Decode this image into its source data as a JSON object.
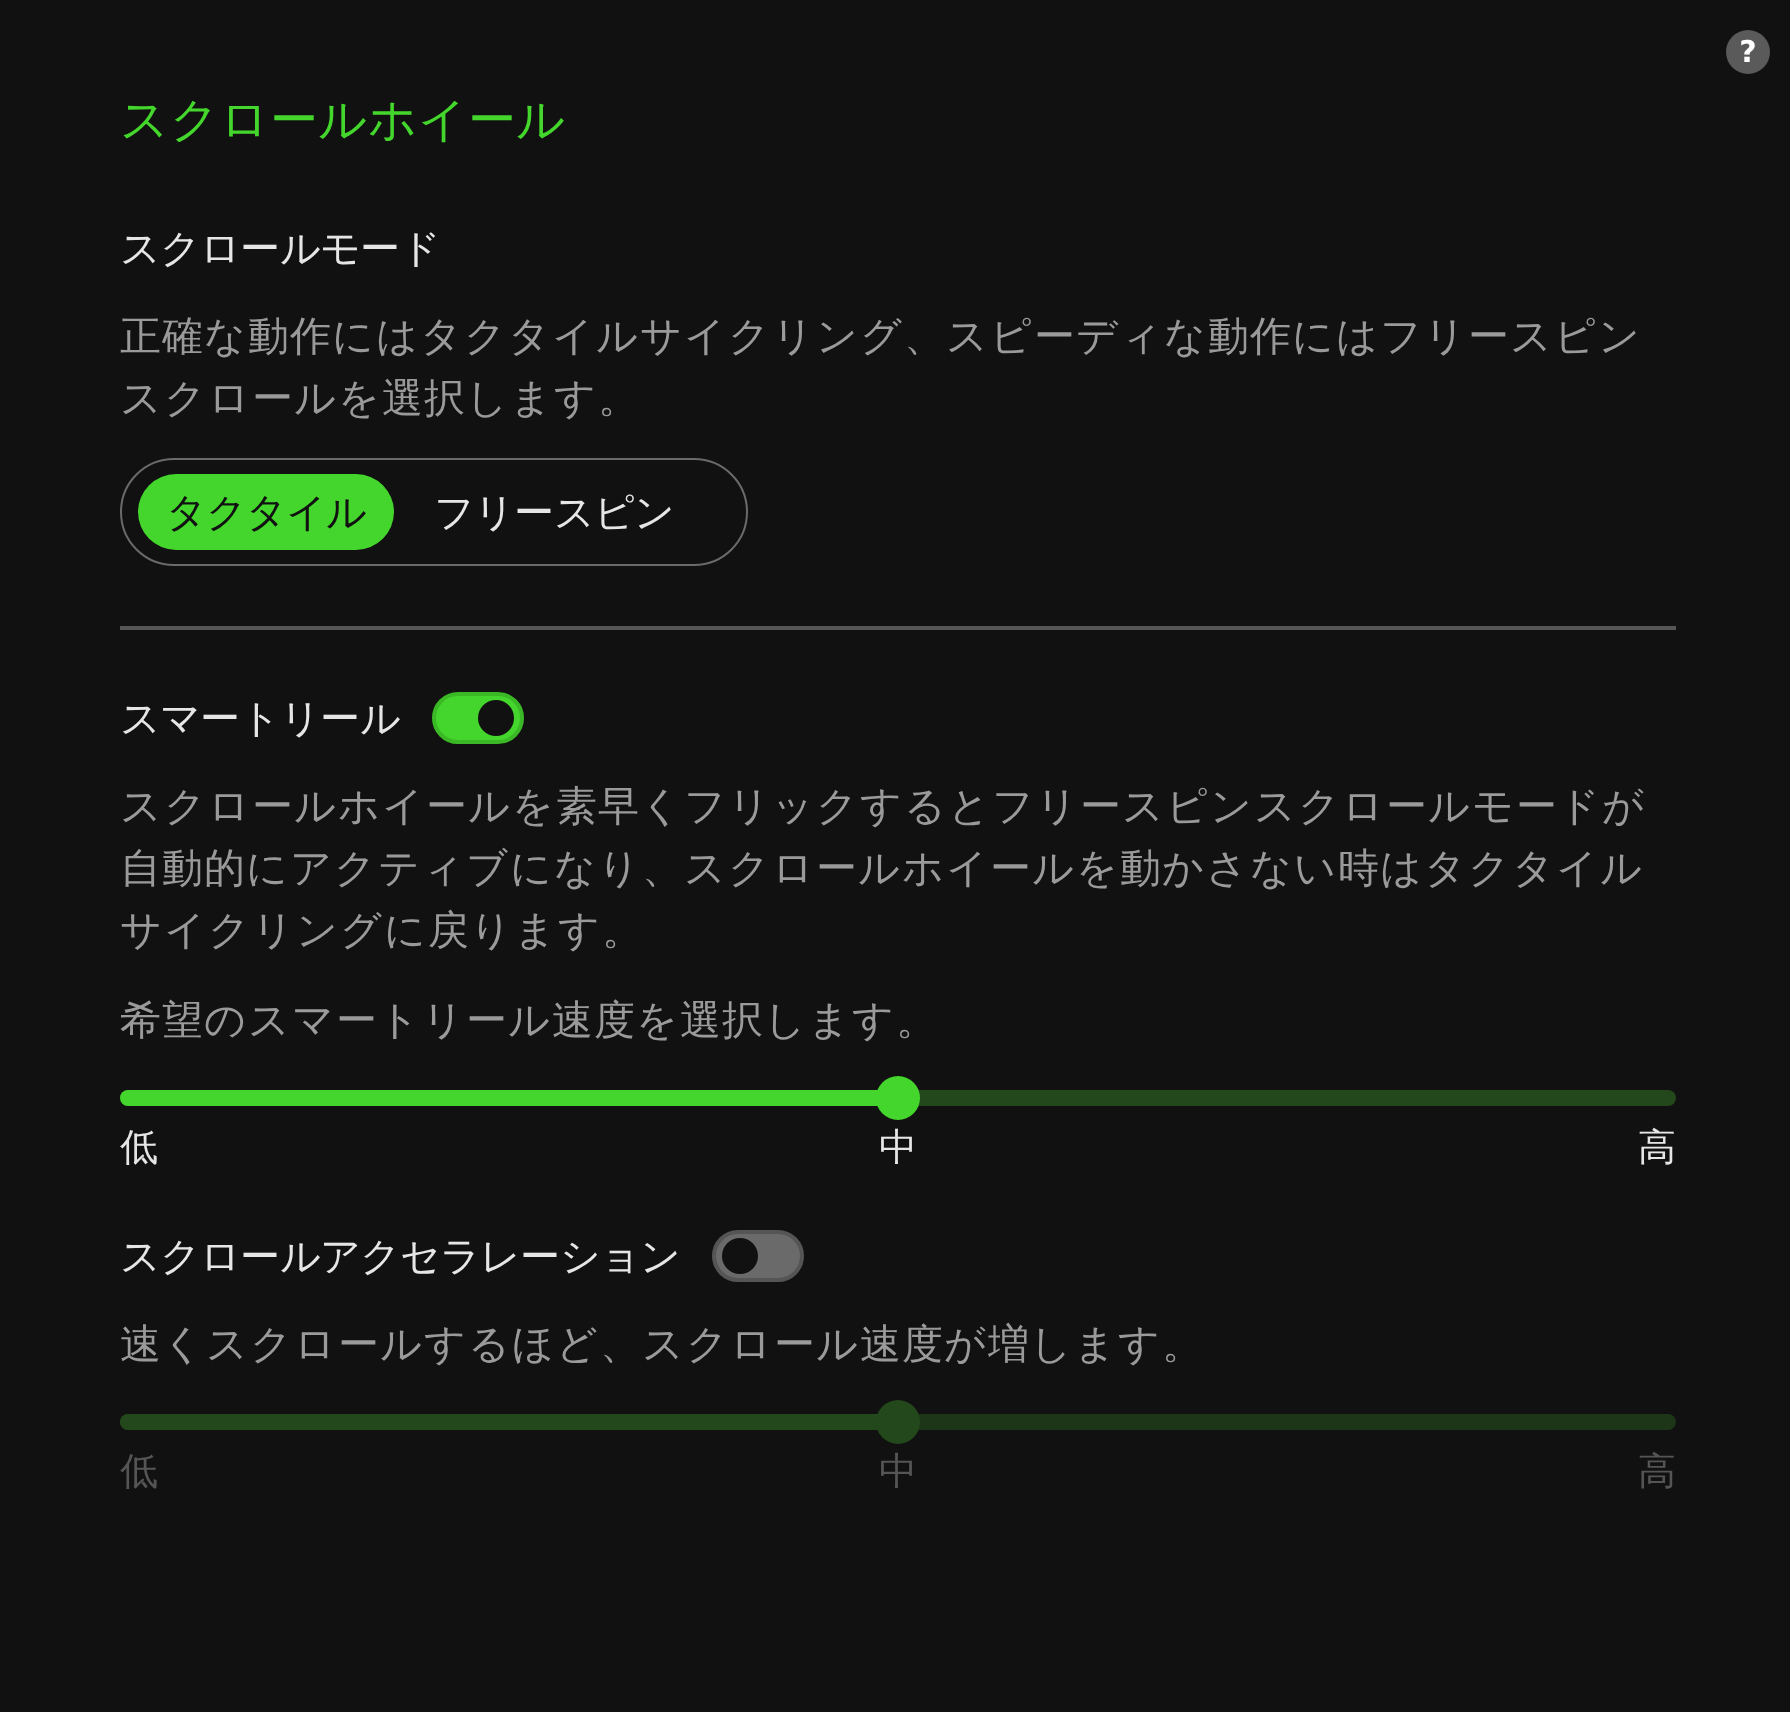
{
  "help": {
    "label": "?"
  },
  "title": "スクロールホイール",
  "scroll_mode": {
    "heading": "スクロールモード",
    "description": "正確な動作にはタクタイルサイクリング、スピーディな動作にはフリースピンスクロールを選択します。",
    "options": [
      {
        "label": "タクタイル",
        "selected": true
      },
      {
        "label": "フリースピン",
        "selected": false
      }
    ]
  },
  "smart_reel": {
    "label": "スマートリール",
    "on": true,
    "description": "スクロールホイールを素早くフリックするとフリースピンスクロールモードが自動的にアクティブになり、スクロールホイールを動かさない時はタクタイルサイクリングに戻ります。",
    "prompt": "希望のスマートリール速度を選択します。",
    "slider": {
      "level": 0.5,
      "disabled": false,
      "labels": [
        "低",
        "中",
        "高"
      ]
    }
  },
  "scroll_acceleration": {
    "label": "スクロールアクセラレーション",
    "on": false,
    "description": "速くスクロールするほど、スクロール速度が増します。",
    "slider": {
      "level": 0.5,
      "disabled": true,
      "labels": [
        "低",
        "中",
        "高"
      ]
    }
  }
}
